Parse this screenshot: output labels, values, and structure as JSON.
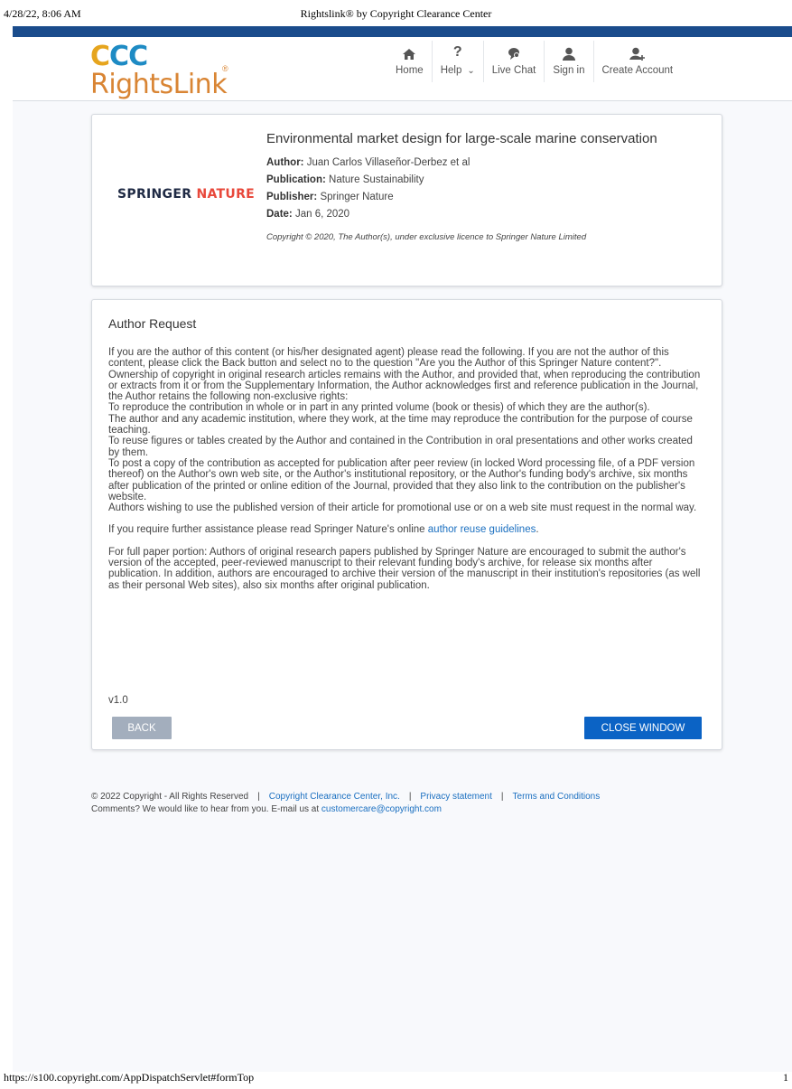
{
  "print_header": {
    "datetime": "4/28/22, 8:06 AM",
    "title": "Rightslink® by Copyright Clearance Center"
  },
  "print_footer": {
    "url": "https://s100.copyright.com/AppDispatchServlet#formTop",
    "page_number": "1"
  },
  "logo": {
    "ccc_letters": [
      "C",
      "C",
      "C"
    ],
    "product": "RightsLink",
    "registered": "®"
  },
  "nav": [
    {
      "icon": "home-icon",
      "label": "Home"
    },
    {
      "icon": "question-icon",
      "label": "Help",
      "chevron": "⌄"
    },
    {
      "icon": "chat-icon",
      "label": "Live Chat"
    },
    {
      "icon": "user-icon",
      "label": "Sign in"
    },
    {
      "icon": "add-user-icon",
      "label": "Create Account"
    }
  ],
  "publisher_logo": {
    "part1": "SPRINGER",
    "part2": "NATURE"
  },
  "article": {
    "title": "Environmental market design for large-scale marine conservation",
    "author_label": "Author:",
    "author": "Juan Carlos Villaseñor-Derbez et al",
    "publication_label": "Publication:",
    "publication": "Nature Sustainability",
    "publisher_label": "Publisher:",
    "publisher": "Springer Nature",
    "date_label": "Date:",
    "date": "Jan 6, 2020",
    "copyright": "Copyright © 2020, The Author(s), under exclusive licence to Springer Nature Limited"
  },
  "request": {
    "heading": "Author Request",
    "paragraphs": [
      "If you are the author of this content (or his/her designated agent) please read the following. If you are not the author of this content, please click the Back button and select no to the question \"Are you the Author of this Springer Nature content?\".",
      "Ownership of copyright in original research articles remains with the Author, and provided that, when reproducing the contribution or extracts from it or from the Supplementary Information, the Author acknowledges first and reference publication in the Journal, the Author retains the following non-exclusive rights:",
      "To reproduce the contribution in whole or in part in any printed volume (book or thesis) of which they are the author(s).",
      "The author and any academic institution, where they work, at the time may reproduce the contribution for the purpose of course teaching.",
      "To reuse figures or tables created by the Author and contained in the Contribution in oral presentations and other works created by them.",
      "To post a copy of the contribution as accepted for publication after peer review (in locked Word processing file, of a PDF version thereof) on the Author's own web site, or the Author's institutional repository, or the Author's funding body's archive, six months after publication of the printed or online edition of the Journal, provided that they also link to the contribution on the publisher's website.",
      "Authors wishing to use the published version of their article for promotional use or on a web site must request in the normal way."
    ],
    "assist_prefix": "If you require further assistance please read Springer Nature's online ",
    "assist_link": "author reuse guidelines",
    "assist_suffix": ".",
    "full_paper": "For full paper portion: Authors of original research papers published by Springer Nature are encouraged to submit the author's version of the accepted, peer-reviewed manuscript to their relevant funding body's archive, for release six months after publication. In addition, authors are encouraged to archive their version of the manuscript in their institution's repositories (as well as their personal Web sites), also six months after original publication.",
    "version": "v1.0",
    "back_label": "BACK",
    "close_label": "CLOSE WINDOW"
  },
  "footer": {
    "copyright": "© 2022 Copyright - All Rights Reserved",
    "separator": "|",
    "link_ccc": "Copyright Clearance Center, Inc.",
    "link_privacy": "Privacy statement",
    "link_terms": "Terms and Conditions",
    "comments_prefix": "Comments? We would like to hear from you. E-mail us at ",
    "email": "customercare@copyright.com"
  },
  "colors": {
    "topbar": "#1a4c8c",
    "primary_button": "#0b63c5",
    "back_button": "#a3aebd",
    "link": "#1a6fc0",
    "springer_red": "#e8483b",
    "rightslink_orange": "#d98534"
  }
}
